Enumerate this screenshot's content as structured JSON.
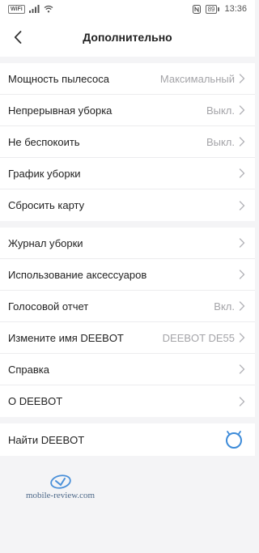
{
  "status_bar": {
    "network_badge": "WiFi",
    "battery": "89",
    "time": "13:36"
  },
  "header": {
    "title": "Дополнительно"
  },
  "group1": [
    {
      "label": "Мощность пылесоса",
      "value": "Максимальный"
    },
    {
      "label": "Непрерывная уборка",
      "value": "Выкл."
    },
    {
      "label": "Не беспокоить",
      "value": "Выкл."
    },
    {
      "label": "График уборки",
      "value": ""
    },
    {
      "label": "Сбросить карту",
      "value": ""
    }
  ],
  "group2": [
    {
      "label": "Журнал уборки",
      "value": ""
    },
    {
      "label": "Использование аксессуаров",
      "value": ""
    },
    {
      "label": "Голосовой отчет",
      "value": "Вкл."
    },
    {
      "label": "Измените имя DEEBOT",
      "value": "DEEBOT DE55"
    },
    {
      "label": "Справка",
      "value": ""
    },
    {
      "label": "О DEEBOT",
      "value": ""
    }
  ],
  "find": {
    "label": "Найти DEEBOT",
    "icon": "robot-icon"
  },
  "watermark": {
    "text": "mobile-review.com"
  },
  "colors": {
    "accent": "#3d8bd9",
    "value_gray": "#a4a4a8",
    "background": "#f4f4f6"
  }
}
